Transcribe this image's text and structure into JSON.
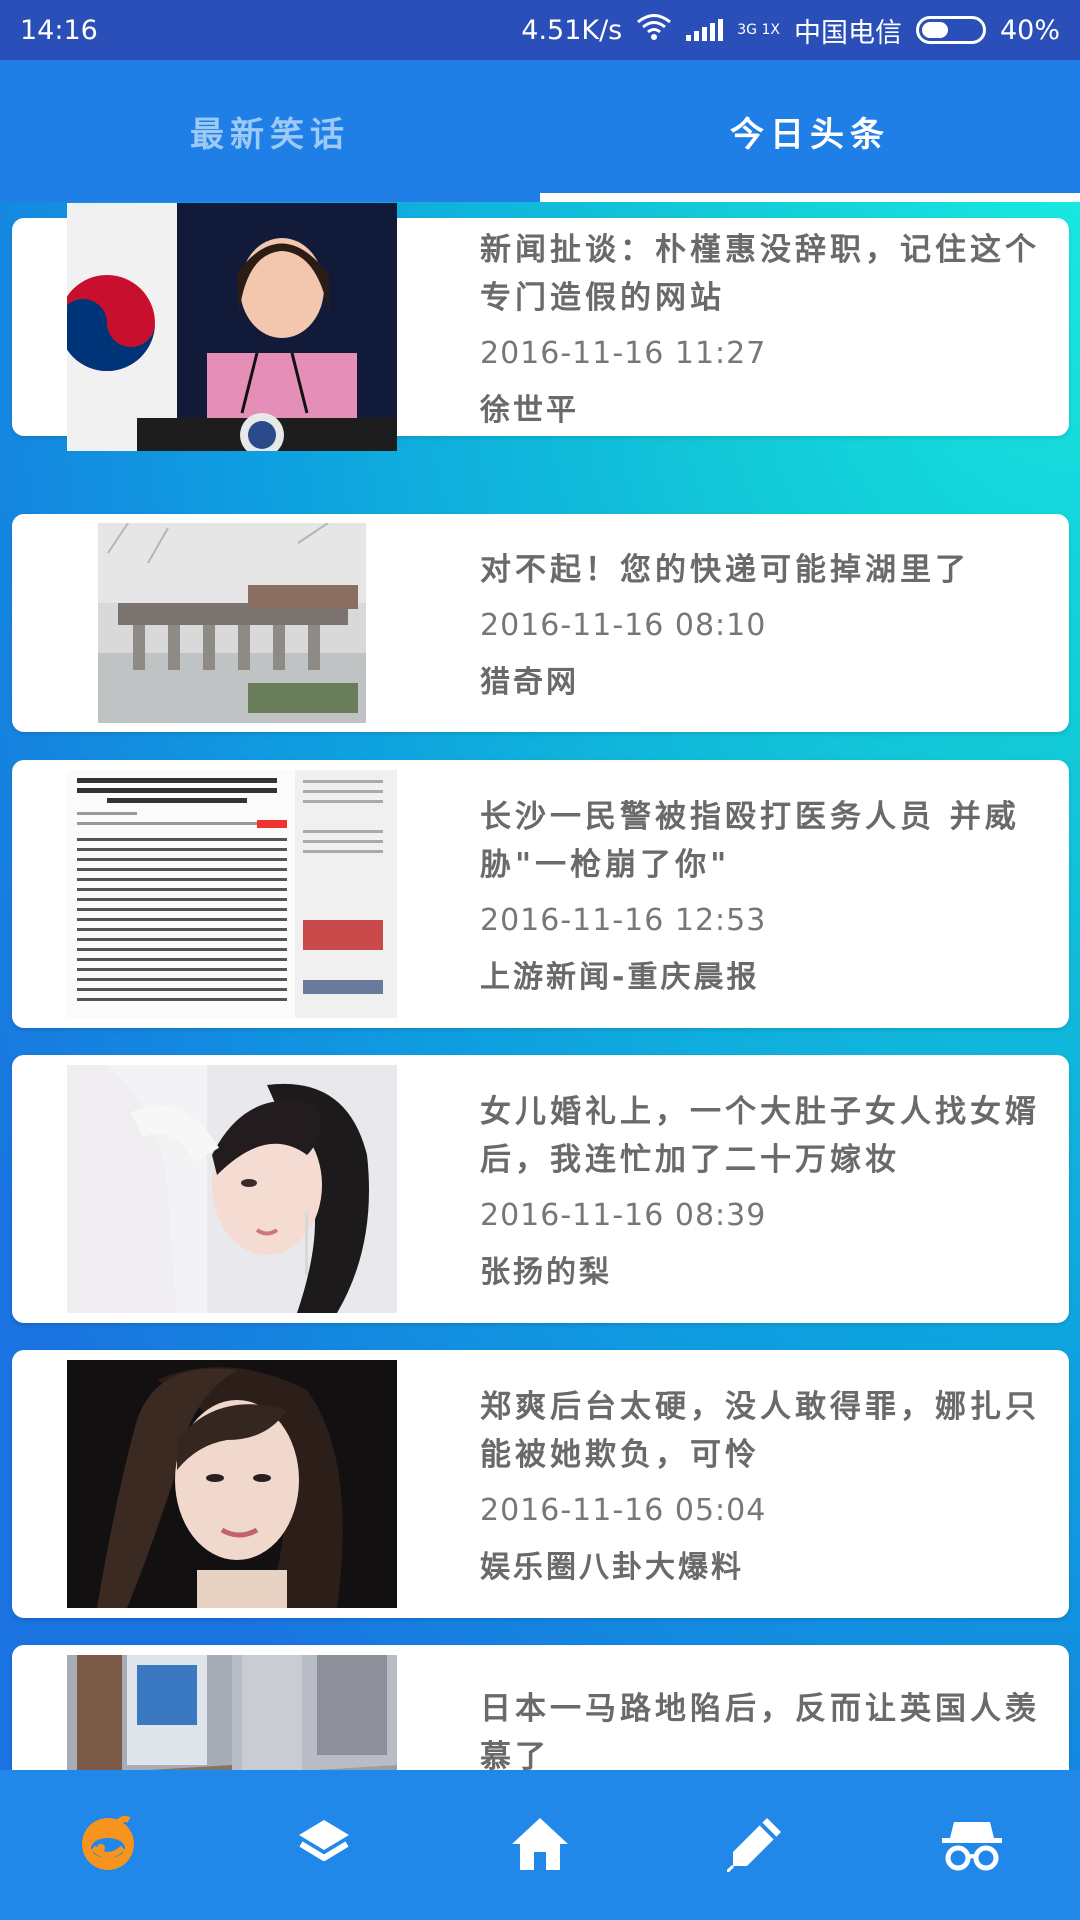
{
  "status_bar": {
    "time": "14:16",
    "speed": "4.51K/s",
    "network": "3G 1X",
    "carrier": "中国电信",
    "battery": "40%"
  },
  "tabs": [
    {
      "label": "最新笑话",
      "active": false
    },
    {
      "label": "今日头条",
      "active": true
    }
  ],
  "news": [
    {
      "title": "新闻扯谈：朴槿惠没辞职，记住这个专门造假的网站",
      "date": "2016-11-16 11:27",
      "source": "徐世平",
      "image": "person-at-podium-photo"
    },
    {
      "title": "对不起！您的快递可能掉湖里了",
      "date": "2016-11-16 08:10",
      "source": "猎奇网",
      "image": "collapsed-bridge-photo"
    },
    {
      "title": "长沙一民警被指殴打医务人员 并威胁\"一枪崩了你\"",
      "date": "2016-11-16 12:53",
      "source": "上游新闻-重庆晨报",
      "image": "news-article-screenshot"
    },
    {
      "title": "女儿婚礼上，一个大肚子女人找女婿后，我连忙加了二十万嫁妆",
      "date": "2016-11-16 08:39",
      "source": "张扬的梨",
      "image": "woman-portrait-photo"
    },
    {
      "title": "郑爽后台太硬，没人敢得罪，娜扎只能被她欺负，可怜",
      "date": "2016-11-16 05:04",
      "source": "娱乐圈八卦大爆料",
      "image": "actress-portrait-photo"
    },
    {
      "title": "日本一马路地陷后，反而让英国人羡慕了",
      "date": "",
      "source": "",
      "image": "road-sinkhole-photo"
    }
  ],
  "bottom_nav": [
    {
      "icon": "penguin-logo-icon",
      "active": true
    },
    {
      "icon": "layers-icon",
      "active": false
    },
    {
      "icon": "home-icon",
      "active": false
    },
    {
      "icon": "pencil-icon",
      "active": false
    },
    {
      "icon": "incognito-icon",
      "active": false
    }
  ],
  "colors": {
    "status_bar": "#2b4fb8",
    "tab_bar": "#1f7fe6",
    "bottom_nav": "#2187e8",
    "active_nav": "#f7941d"
  }
}
